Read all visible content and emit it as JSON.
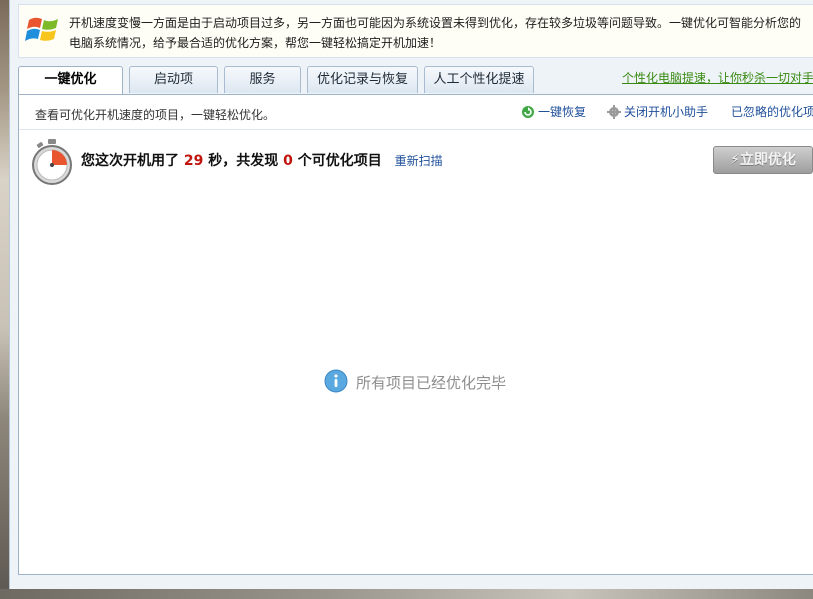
{
  "tip": {
    "line1": "开机速度变慢一方面是由于启动项目过多，另一方面也可能因为系统设置未得到优化，存在较多垃圾等问题导致。一键优化可智能分析您的",
    "line2": "电脑系统情况，给予最合适的优化方案，帮您一键轻松搞定开机加速！"
  },
  "tabs": [
    {
      "label": "一键优化",
      "active": true
    },
    {
      "label": "启动项",
      "active": false
    },
    {
      "label": "服务",
      "active": false
    },
    {
      "label": "优化记录与恢复",
      "active": false
    },
    {
      "label": "人工个性化提速",
      "active": false
    }
  ],
  "promo_link": "个性化电脑提速，让你秒杀一切对手",
  "subbar": {
    "description": "查看可优化开机速度的项目，一键轻松优化。",
    "restore": "一键恢复",
    "close_helper": "关闭开机小助手",
    "ignored": "已忽略的优化项"
  },
  "status": {
    "prefix": "您这次开机用了",
    "seconds": "29",
    "middle": "秒，共发现",
    "count": "0",
    "suffix": "个可优化项目",
    "rescan": "重新扫描"
  },
  "optimize_button": "⚡立即优化",
  "empty_message": "所有项目已经优化完毕",
  "colors": {
    "accent": "#1f4f9a",
    "highlight_number": "#c0140d",
    "promo": "#3a8a12"
  }
}
